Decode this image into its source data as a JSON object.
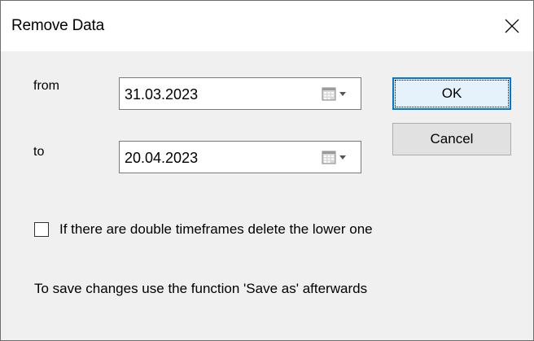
{
  "window": {
    "title": "Remove Data"
  },
  "form": {
    "from_label": "from",
    "from_value": "31.03.2023",
    "to_label": "to",
    "to_value": "20.04.2023"
  },
  "buttons": {
    "ok_label": "OK",
    "cancel_label": "Cancel"
  },
  "options": {
    "double_timeframes_label": "If there are double timeframes delete the lower one",
    "double_timeframes_checked": false
  },
  "info": {
    "note": "To save changes use the function 'Save as' afterwards"
  },
  "icons": {
    "close": "close-icon",
    "calendar": "calendar-dropdown-icon"
  },
  "colors": {
    "dialog_bg": "#f0f0f0",
    "titlebar_bg": "#ffffff",
    "default_button_border": "#0078d7"
  }
}
